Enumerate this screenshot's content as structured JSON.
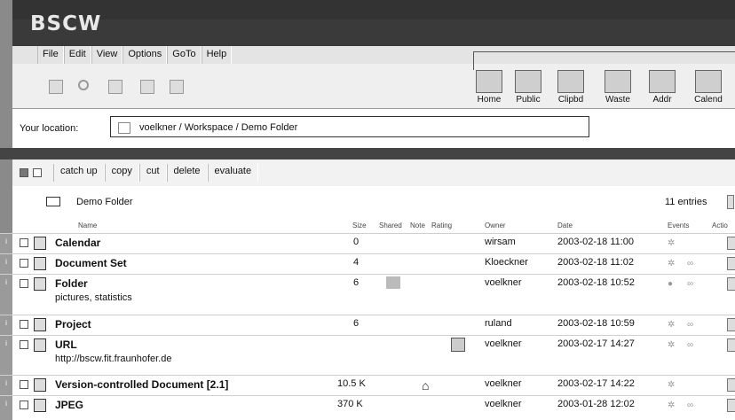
{
  "app": {
    "logo": "BSCW"
  },
  "menu": [
    "File",
    "Edit",
    "View",
    "Options",
    "GoTo",
    "Help"
  ],
  "navigation": [
    "Home",
    "Public",
    "Clipbd",
    "Waste",
    "Addr",
    "Calend"
  ],
  "location": {
    "label": "Your location:",
    "path": "voelkner / Workspace",
    "current": "/ Demo Folder"
  },
  "actions": [
    "catch up",
    "copy",
    "cut",
    "delete",
    "evaluate"
  ],
  "folder": {
    "name": "Demo Folder",
    "entries": "11 entries"
  },
  "columns": [
    "Name",
    "Size",
    "Shared",
    "Note",
    "Rating",
    "Owner",
    "Date",
    "Events",
    "Actio"
  ],
  "rows": [
    {
      "name": "Calendar",
      "size": "0",
      "owner": "wirsam",
      "date": "2003-02-18 11:00"
    },
    {
      "name": "Document Set",
      "size": "4",
      "owner": "Kloeckner",
      "date": "2003-02-18 11:02"
    },
    {
      "name": "Folder",
      "sub": "pictures, statistics",
      "size": "6",
      "owner": "voelkner",
      "date": "2003-02-18 10:52"
    },
    {
      "name": "Project",
      "size": "6",
      "owner": "ruland",
      "date": "2003-02-18 10:59"
    },
    {
      "name": "URL",
      "sub": "http://bscw.fit.fraunhofer.de",
      "size": "",
      "owner": "voelkner",
      "date": "2003-02-17 14:27"
    },
    {
      "name": "Version-controlled Document [2.1]",
      "size": "10.5 K",
      "owner": "voelkner",
      "date": "2003-02-17 14:22"
    },
    {
      "name": "JPEG",
      "size": "370 K",
      "owner": "voelkner",
      "date": "2003-01-28 12:02"
    }
  ],
  "icons": {
    "home": "home-icon",
    "public": "public-icon",
    "clipboard": "clipboard-icon",
    "waste": "trash-icon",
    "address": "address-book-icon",
    "calendar": "calendar-icon"
  }
}
